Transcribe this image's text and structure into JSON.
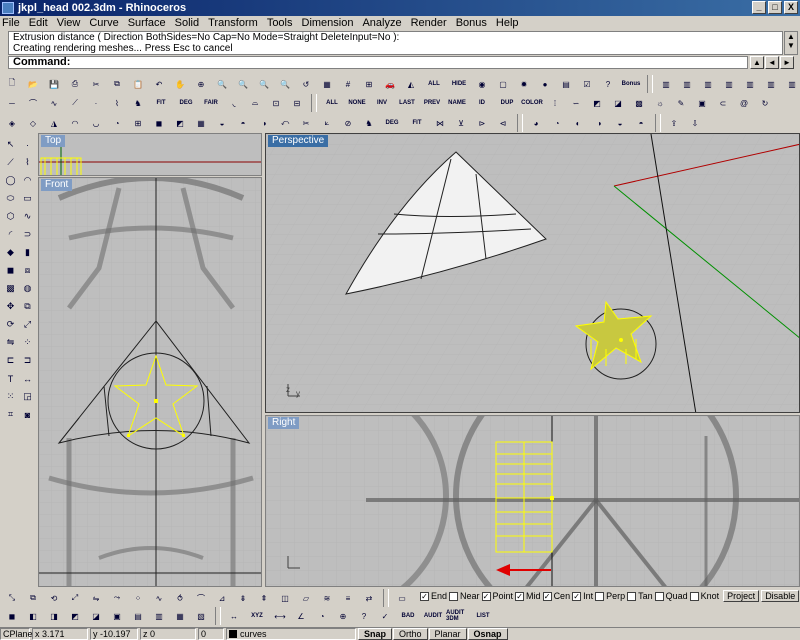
{
  "window": {
    "title": "jkpl_head 002.3dm - Rhinoceros",
    "minimize": "_",
    "maximize": "□",
    "close": "X"
  },
  "menu": [
    "File",
    "Edit",
    "View",
    "Curve",
    "Surface",
    "Solid",
    "Transform",
    "Tools",
    "Dimension",
    "Analyze",
    "Render",
    "Bonus",
    "Help"
  ],
  "command": {
    "history_line1": "Extrusion distance ( Direction  BothSides=No  Cap=No  Mode=Straight  DeleteInput=No ):",
    "history_line2": "Creating rendering meshes... Press Esc to cancel",
    "prompt": "Command:"
  },
  "toolbar_labels": {
    "all": "ALL",
    "hide": "HIDE",
    "bonus": "Bonus",
    "fit": "FIT",
    "deg": "DEG",
    "fair": "FAIR",
    "all2": "ALL",
    "none": "NONE",
    "inv": "INV",
    "last": "LAST",
    "prev": "PREV",
    "name": "NAME",
    "id": "ID",
    "dup": "DUP",
    "color": "COLOR",
    "bad": "BAD",
    "audit": "AUDIT",
    "audit3dm": "AUDIT 3DM",
    "list": "LIST",
    "xyz": "XYZ"
  },
  "viewports": {
    "top": "Top",
    "front": "Front",
    "perspective": "Perspective",
    "right": "Right"
  },
  "osnap": {
    "items": [
      {
        "label": "End",
        "checked": true
      },
      {
        "label": "Near",
        "checked": false
      },
      {
        "label": "Point",
        "checked": true
      },
      {
        "label": "Mid",
        "checked": true
      },
      {
        "label": "Cen",
        "checked": true
      },
      {
        "label": "Int",
        "checked": true
      },
      {
        "label": "Perp",
        "checked": false
      },
      {
        "label": "Tan",
        "checked": false
      },
      {
        "label": "Quad",
        "checked": false
      },
      {
        "label": "Knot",
        "checked": false
      }
    ],
    "project": "Project",
    "disable": "Disable"
  },
  "status": {
    "cplane": "CPlane",
    "x": "x 3.171",
    "y": "y -10.197",
    "z": "z 0",
    "zero": "0",
    "layer": "curves",
    "snap": "Snap",
    "ortho": "Ortho",
    "planar": "Planar",
    "osnap": "Osnap"
  },
  "colors": {
    "title_start": "#0a246a",
    "title_end": "#3a6ea5",
    "viewport_bg": "#bebebe",
    "selected": "#ffff00"
  }
}
